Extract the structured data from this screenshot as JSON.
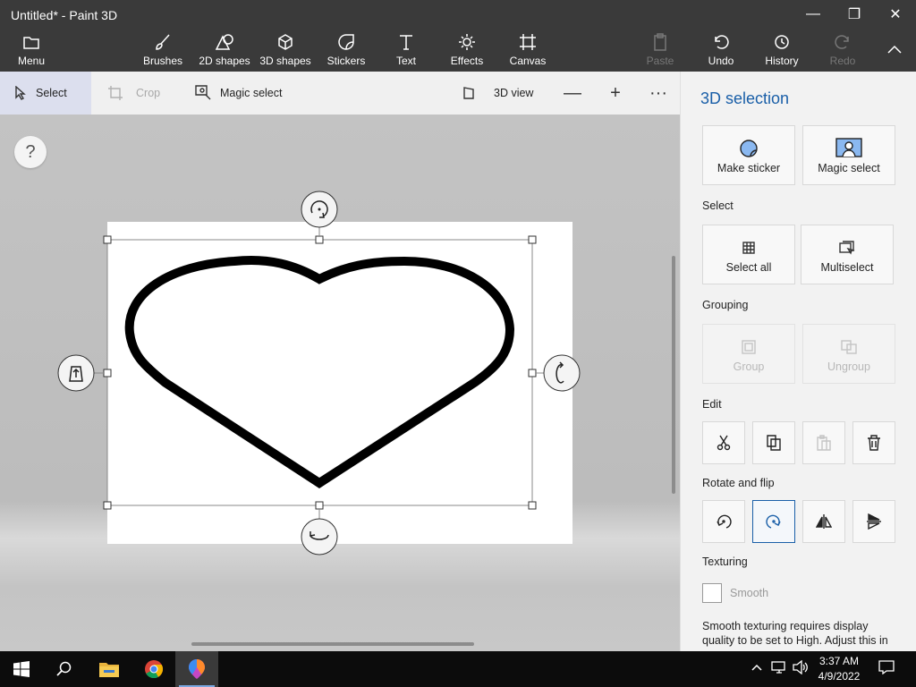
{
  "window": {
    "title": "Untitled* - Paint 3D",
    "minimize_glyph": "—",
    "restore_glyph": "❐",
    "close_glyph": "✕"
  },
  "ribbon": {
    "menu": "Menu",
    "brushes": "Brushes",
    "shapes2d": "2D shapes",
    "shapes3d": "3D shapes",
    "stickers": "Stickers",
    "text": "Text",
    "effects": "Effects",
    "canvas": "Canvas",
    "paste": "Paste",
    "undo": "Undo",
    "history": "History",
    "redo": "Redo"
  },
  "toolstrip": {
    "select": "Select",
    "crop": "Crop",
    "magic_select": "Magic select",
    "view3d": "3D view",
    "zoom_out": "—",
    "zoom_in": "+",
    "more": "···"
  },
  "workspace": {
    "help": "?"
  },
  "panel": {
    "title": "3D selection",
    "make_sticker": "Make sticker",
    "magic_select": "Magic select",
    "select_label": "Select",
    "select_all": "Select all",
    "multiselect": "Multiselect",
    "grouping_label": "Grouping",
    "group": "Group",
    "ungroup": "Ungroup",
    "edit_label": "Edit",
    "rotate_flip_label": "Rotate and flip",
    "texturing_label": "Texturing",
    "smooth": "Smooth",
    "note": "Smooth texturing requires display quality to be set to High. Adjust this in"
  },
  "taskbar": {
    "time": "3:37 AM",
    "date": "4/9/2022"
  },
  "colors": {
    "accent": "#1a5fa8",
    "titlebar": "#3a3a3a",
    "toolstrip": "#f0f0f0",
    "panel": "#f2f2f2"
  }
}
